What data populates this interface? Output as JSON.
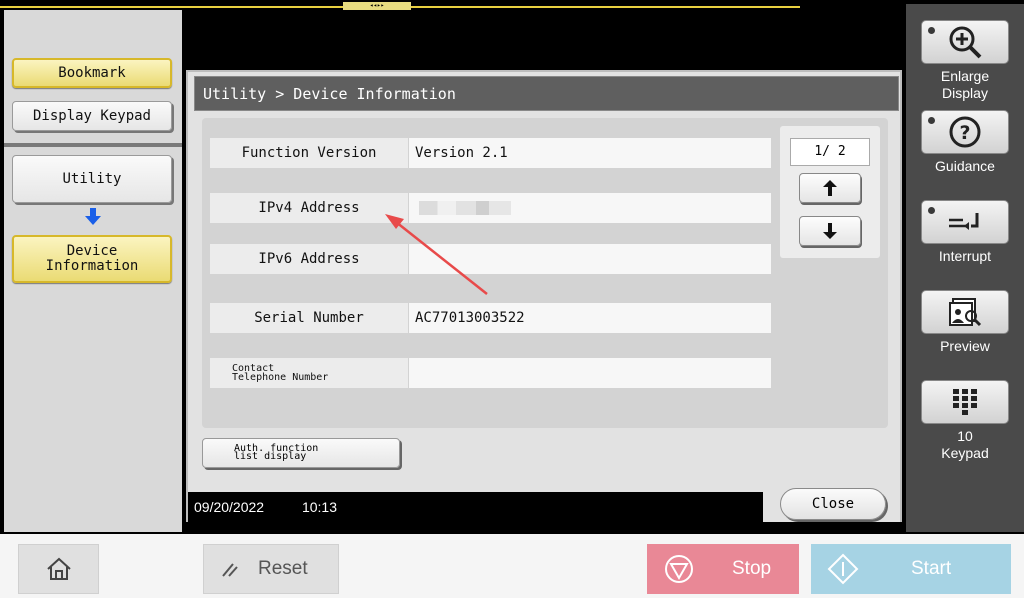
{
  "topbar": {
    "grip": "◂◂▸▸"
  },
  "left_panel": {
    "bookmark_label": "Bookmark",
    "display_keypad_label": "Display Keypad",
    "utility_label": "Utility",
    "device_info_line1": "Device",
    "device_info_line2": "Information"
  },
  "dialog": {
    "title": "Utility > Device Information",
    "rows": [
      {
        "label": "Function Version",
        "value": "Version 2.1"
      },
      {
        "label": "IPv4 Address",
        "value": ""
      },
      {
        "label": "IPv6 Address",
        "value": ""
      },
      {
        "label": "Serial Number",
        "value": "AC77013003522"
      },
      {
        "label_line1": "Contact",
        "label_line2": "Telephone Number",
        "value": ""
      }
    ],
    "page_indicator": "1/ 2",
    "auth_line1": "Auth. function",
    "auth_line2": "list display",
    "close_label": "Close"
  },
  "status": {
    "date": "09/20/2022",
    "time": "10:13"
  },
  "right_panel": {
    "enlarge_line1": "Enlarge",
    "enlarge_line2": "Display",
    "guidance": "Guidance",
    "interrupt": "Interrupt",
    "preview": "Preview",
    "keypad_line1": "10",
    "keypad_line2": "Keypad"
  },
  "bottom": {
    "reset_label": "Reset",
    "stop_label": "Stop",
    "start_label": "Start"
  },
  "colors": {
    "accent_yellow": "#eadb74",
    "stop": "#e98896",
    "start": "#a6d3e4",
    "annotation_arrow": "#e84a4a"
  }
}
